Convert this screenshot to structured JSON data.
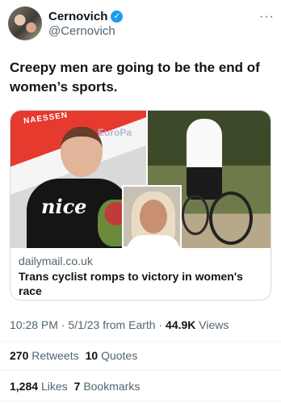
{
  "header": {
    "display_name": "Cernovich",
    "handle": "@Cernovich",
    "more": "···"
  },
  "tweet": {
    "text": "Creepy men are going to be the end of women’s sports."
  },
  "card": {
    "banner_left": "NAESSEN",
    "banner_right": "EuroPa",
    "jersey_text": "nice",
    "domain": "dailymail.co.uk",
    "title": "Trans cyclist romps to victory in women's race"
  },
  "meta": {
    "time": "10:28 PM",
    "date": "5/1/23",
    "source": "from Earth",
    "views_count": "44.9K",
    "views_label": "Views"
  },
  "stats": {
    "retweets": {
      "count": "270",
      "label": "Retweets"
    },
    "quotes": {
      "count": "10",
      "label": "Quotes"
    },
    "likes": {
      "count": "1,284",
      "label": "Likes"
    },
    "bookmarks": {
      "count": "7",
      "label": "Bookmarks"
    }
  },
  "colors": {
    "accent": "#1d9bf0",
    "text": "#0f1419",
    "secondary": "#536471"
  },
  "icons": [
    "verified-badge-icon",
    "more-icon"
  ]
}
